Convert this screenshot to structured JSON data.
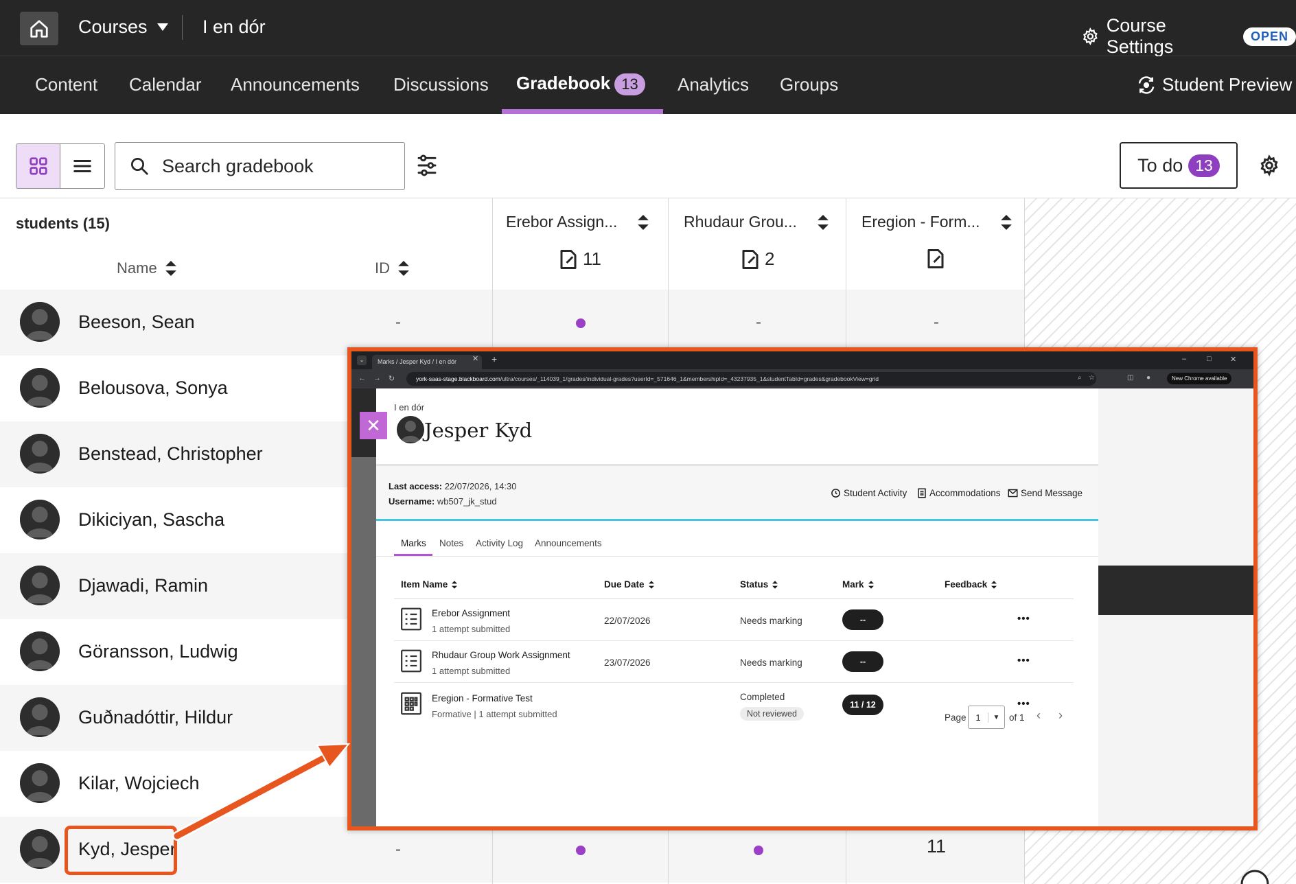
{
  "topbar": {
    "courses_label": "Courses",
    "course_name": "I en dór",
    "settings_label": "Course Settings",
    "open_badge": "OPEN"
  },
  "tabs": {
    "content": "Content",
    "calendar": "Calendar",
    "announcements": "Announcements",
    "discussions": "Discussions",
    "gradebook": "Gradebook",
    "gradebook_count": "13",
    "analytics": "Analytics",
    "groups": "Groups",
    "student_preview": "Student Preview"
  },
  "toolbar": {
    "search_placeholder": "Search gradebook",
    "todo_label": "To do",
    "todo_count": "13"
  },
  "grid": {
    "students_title": "students (15)",
    "name_header": "Name",
    "id_header": "ID",
    "columns": [
      {
        "title": "Erebor Assign...",
        "count": "11"
      },
      {
        "title": "Rhudaur Grou...",
        "count": "2"
      },
      {
        "title": "Eregion - Form...",
        "count": ""
      }
    ],
    "rows": [
      {
        "name": "Beeson, Sean",
        "id": "-",
        "c2": "-",
        "c3": "-"
      },
      {
        "name": "Belousova, Sonya"
      },
      {
        "name": "Benstead, Christopher"
      },
      {
        "name": "Dikiciyan, Sascha"
      },
      {
        "name": "Djawadi, Ramin"
      },
      {
        "name": "Göransson, Ludwig"
      },
      {
        "name": "Guðnadóttir, Hildur"
      },
      {
        "name": "Kilar, Wojciech"
      },
      {
        "name": "Kyd, Jesper",
        "id": "-",
        "c3": "11"
      }
    ]
  },
  "popup": {
    "browser": {
      "tab_title": "Marks / Jesper Kyd / I en dór",
      "url_host": "york-saas-stage.blackboard.com",
      "url_path": "/ultra/courses/_114039_1/grades/individual-grades?userId=_571646_1&membershipId=_43237935_1&studentTabId=grades&gradebookView=grid",
      "new_chrome": "New Chrome available"
    },
    "breadcrumb": "I en dór",
    "student_name": "Jesper Kyd",
    "last_access_label": "Last access:",
    "last_access_value": "22/07/2026, 14:30",
    "username_label": "Username:",
    "username_value": "wb507_jk_stud",
    "actions": {
      "activity": "Student Activity",
      "accommodations": "Accommodations",
      "message": "Send Message"
    },
    "tabs": {
      "marks": "Marks",
      "notes": "Notes",
      "activity_log": "Activity Log",
      "announcements": "Announcements"
    },
    "headers": {
      "item": "Item Name",
      "due": "Due Date",
      "status": "Status",
      "mark": "Mark",
      "feedback": "Feedback"
    },
    "items": [
      {
        "title": "Erebor Assignment",
        "sub": "1 attempt submitted",
        "due": "22/07/2026",
        "status": "Needs marking",
        "mark": "--"
      },
      {
        "title": "Rhudaur Group Work Assignment",
        "sub": "1 attempt submitted",
        "due": "23/07/2026",
        "status": "Needs marking",
        "mark": "--"
      },
      {
        "title": "Eregion - Formative Test",
        "sub": "Formative | 1 attempt submitted",
        "due": "",
        "status": "Completed",
        "badge": "Not reviewed",
        "mark": "11 / 12"
      }
    ],
    "pager": {
      "page_label": "Page",
      "page_value": "1",
      "of_label": "of 1"
    }
  },
  "colors": {
    "accent": "#8e3fbf",
    "highlight": "#e8561f",
    "topbar": "#262626"
  }
}
